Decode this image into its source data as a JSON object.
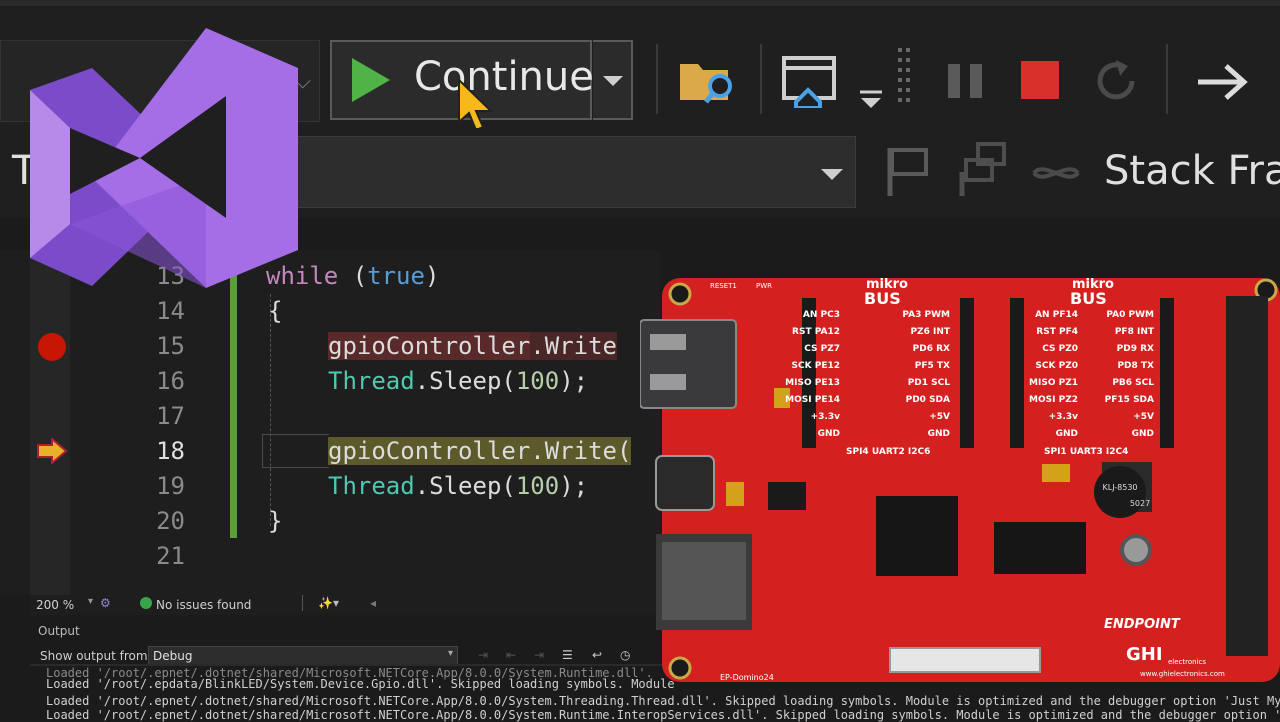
{
  "toolbar": {
    "continue_label": "Continue",
    "thread_label": "Thre",
    "stack_frame_label": "Stack Fran"
  },
  "editor": {
    "lines": [
      {
        "num": "13",
        "current": false
      },
      {
        "num": "14",
        "current": false
      },
      {
        "num": "15",
        "current": false
      },
      {
        "num": "16",
        "current": false
      },
      {
        "num": "17",
        "current": false
      },
      {
        "num": "18",
        "current": true
      },
      {
        "num": "19",
        "current": false
      },
      {
        "num": "20",
        "current": false
      },
      {
        "num": "21",
        "current": false
      }
    ],
    "code": {
      "l13_kw": "while",
      "l13_rest": " (",
      "l13_true": "true",
      "l13_close": ")",
      "l14": "{",
      "l15_obj": "gpioController",
      "l15_rest": ".Write",
      "l16_type": "Thread",
      "l16_rest": ".Sleep(",
      "l16_num": "100",
      "l16_end": ");",
      "l18_obj": "gpioController",
      "l18_rest": ".Write(",
      "l19_type": "Thread",
      "l19_rest": ".Sleep(",
      "l19_num": "100",
      "l19_end": ");",
      "l20": "}"
    }
  },
  "statusbar": {
    "zoom": "200 %",
    "issues": "No issues found"
  },
  "output": {
    "title": "Output",
    "show_from_label": "Show output from:",
    "source": "Debug",
    "lines": [
      "Loaded '/root/.epdata/BlinkLED/System.Device.Gpio.dll'. Skipped loading symbols. Module",
      "Loaded '/root/.epnet/.dotnet/shared/Microsoft.NETCore.App/8.0.0/System.Threading.Thread.dll'. Skipped loading symbols. Module is optimized and the debugger option 'Just My",
      "Loaded '/root/.epnet/.dotnet/shared/Microsoft.NETCore.App/8.0.0/System.Runtime.InteropServices.dll'. Skipped loading symbols. Module is optimized and the debugger option '"
    ]
  },
  "board": {
    "mikrobus_left": [
      "mikro",
      "BUS"
    ],
    "mikrobus_right": [
      "mikro",
      "BUS"
    ],
    "left_pins_a": [
      "AN PC3",
      "RST PA12",
      "CS PZ7",
      "SCK PE12",
      "MISO PE13",
      "MOSI PE14",
      "+3.3v",
      "GND"
    ],
    "left_pins_b": [
      "PA3 PWM",
      "PZ6 INT",
      "PD6 RX",
      "PF5 TX",
      "PD1 SCL",
      "PD0 SDA",
      "+5V",
      "GND"
    ],
    "right_pins_a": [
      "AN PF14",
      "RST PF4",
      "CS PZ0",
      "SCK PZ0",
      "MISO PZ1",
      "MOSI PZ2",
      "+3.3v",
      "GND"
    ],
    "right_pins_b": [
      "PA0 PWM",
      "PF8 INT",
      "PD9 RX",
      "PD8 TX",
      "PB6 SCL",
      "PF15 SDA",
      "+5V",
      "GND"
    ],
    "bus_left_caption": "SPI4 UART2 I2C6",
    "bus_right_caption": "SPI1 UART3 I2C4",
    "buzzer_label": "KLJ-8530",
    "buzzer_sub": "5027",
    "brand": "ENDPOINT",
    "maker": "GHI",
    "maker_sub": "electronics",
    "model": "EP-Domino24",
    "url": "www.ghielectronics.com",
    "reset": "RESET1",
    "pwr": "PWR"
  },
  "colors": {
    "board_red": "#d4201e",
    "vs_purple": "#8e59d6",
    "play_green": "#4fb346",
    "stop_red": "#d9302c"
  }
}
